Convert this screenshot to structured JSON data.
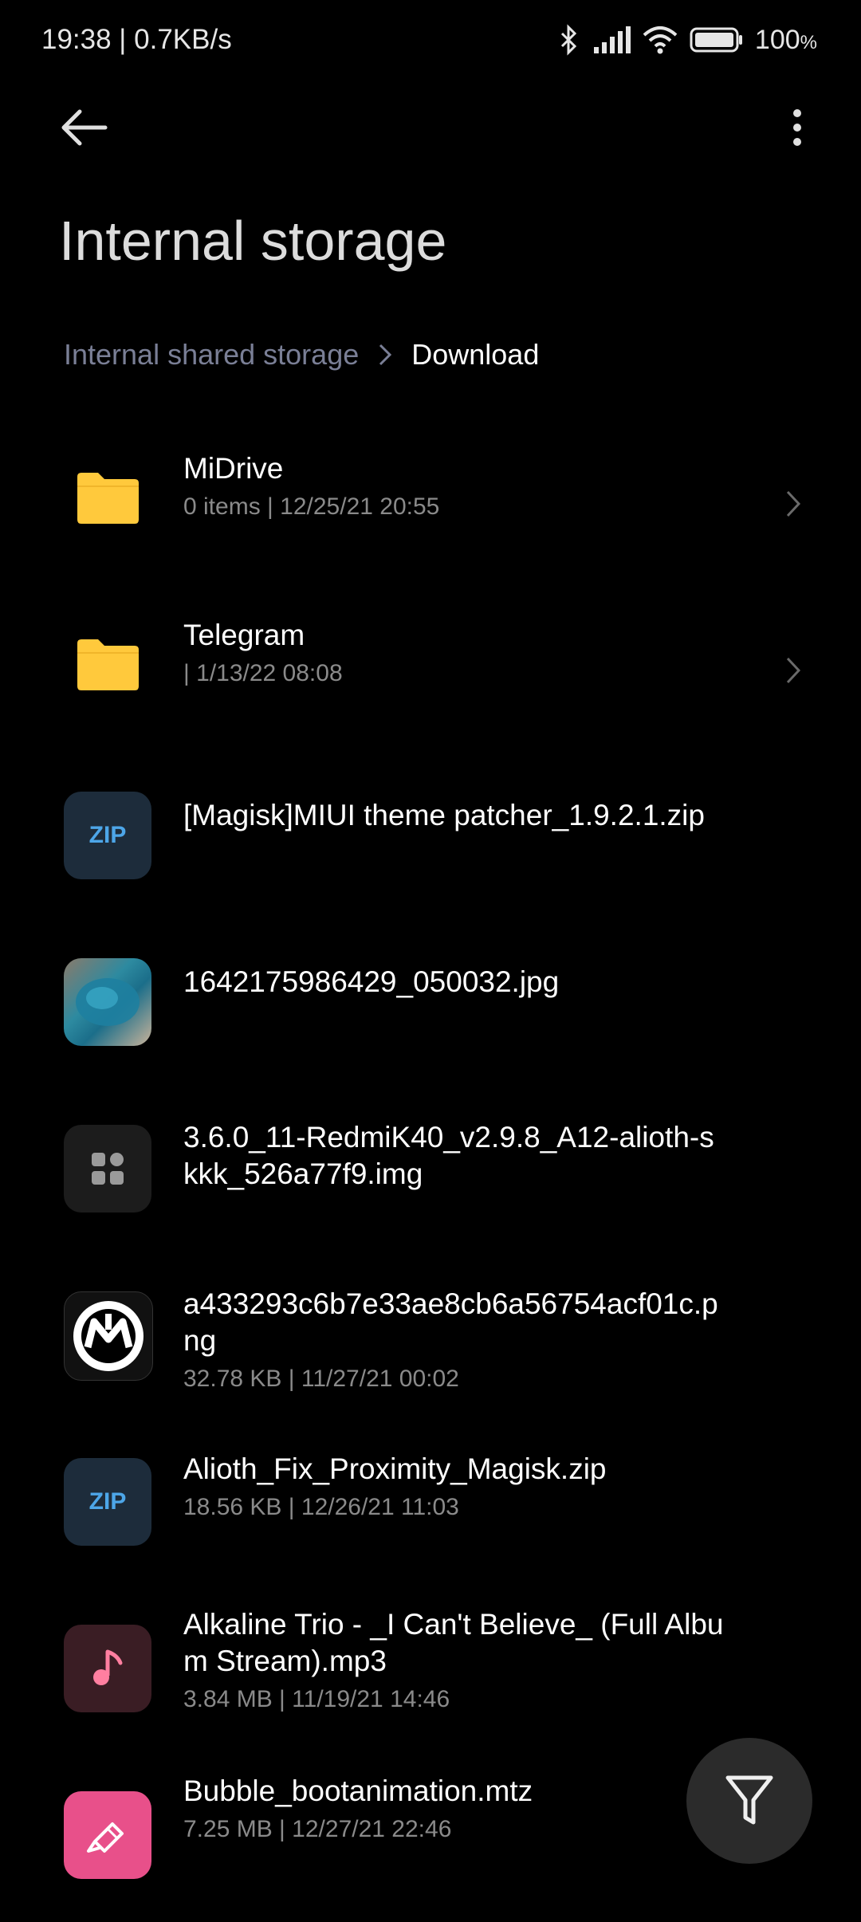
{
  "status_bar": {
    "time": "19:38 | 0.7KB/s",
    "battery": "100",
    "battery_unit": "%"
  },
  "app_bar": {
    "back_icon": "arrow-left-icon",
    "menu_icon": "more-vertical-icon"
  },
  "page_title": "Internal storage",
  "breadcrumb": {
    "root": "Internal shared storage",
    "current": "Download"
  },
  "files": [
    {
      "name": "MiDrive",
      "meta": "0 items  |  12/25/21 20:55",
      "type": "folder"
    },
    {
      "name": "Telegram",
      "meta": "  |  1/13/22 08:08",
      "type": "folder"
    },
    {
      "name": "[Magisk]MIUI theme patcher_1.9.2.1.zip",
      "meta": "",
      "type": "zip",
      "badge": "ZIP"
    },
    {
      "name": "1642175986429_050032.jpg",
      "meta": "",
      "type": "jpg"
    },
    {
      "name": "3.6.0_11-RedmiK40_v2.9.8_A12-alioth-skkk_526a77f9.img",
      "meta": "",
      "type": "img"
    },
    {
      "name": "a433293c6b7e33ae8cb6a56754acf01c.png",
      "meta": "32.78 KB  |  11/27/21 00:02",
      "type": "png"
    },
    {
      "name": "Alioth_Fix_Proximity_Magisk.zip",
      "meta": "18.56 KB  |  12/26/21 11:03",
      "type": "zip",
      "badge": "ZIP"
    },
    {
      "name": "Alkaline Trio - _I Can't Believe_ (Full Album Stream).mp3",
      "meta": "3.84 MB  |  11/19/21 14:46",
      "type": "mp3"
    },
    {
      "name": "Bubble_bootanimation.mtz",
      "meta": "7.25 MB  |  12/27/21 22:46",
      "type": "mtz"
    }
  ],
  "colors": {
    "background": "#000000",
    "folder": "#ffc93c",
    "zip_text": "#4da6e8",
    "mtz": "#e8508a",
    "mp3_note": "#ff7fa0"
  }
}
